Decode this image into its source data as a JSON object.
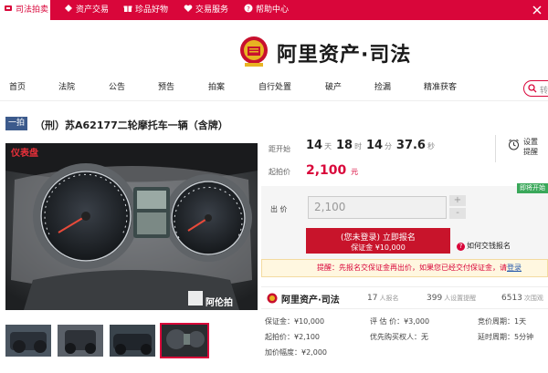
{
  "topbar": {
    "tabs": [
      {
        "label": "司法拍卖",
        "icon": "gavel-icon",
        "active": true
      },
      {
        "label": "资产交易",
        "icon": "diamond-icon",
        "active": false
      },
      {
        "label": "珍品好物",
        "icon": "gift-icon",
        "active": false
      },
      {
        "label": "交易服务",
        "icon": "heart-icon",
        "active": false
      },
      {
        "label": "帮助中心",
        "icon": "question-icon",
        "active": false
      }
    ],
    "close_icon": "close-icon",
    "bg_color": "#d9063a"
  },
  "header": {
    "logo_text": "阿里资产·司法"
  },
  "nav": {
    "items": [
      "首页",
      "法院",
      "公告",
      "预告",
      "拍案",
      "自行处置",
      "破产",
      "捡漏",
      "精准获客"
    ],
    "search_placeholder": "转"
  },
  "item": {
    "badge": "一拍",
    "title": "（刑）苏A62177二轮摩托车一辆（含牌）",
    "photo_tag": "仪表盘",
    "watermark": "阿伦拍"
  },
  "countdown": {
    "label": "距开始",
    "days": "14",
    "days_unit": "天",
    "hours": "18",
    "hours_unit": "时",
    "minutes": "14",
    "minutes_unit": "分",
    "seconds": "37.6",
    "seconds_unit": "秒"
  },
  "reminder": {
    "line1": "设置",
    "line2": "提醒"
  },
  "start_price": {
    "label": "起拍价",
    "value": "2,100",
    "unit": "元"
  },
  "bid": {
    "status_tag": "即将开始",
    "label": "出 价",
    "value": "2,100",
    "plus": "+",
    "minus": "-",
    "signup_line1": "(您未登录) 立即报名",
    "signup_line2": "保证金 ¥10,000",
    "howto": "如何交钱报名"
  },
  "tip": {
    "prefix": "提醒：先报名交保证金再出价，如果您已经交付保证金，请",
    "link": "登录"
  },
  "stats": {
    "logo": "阿里资产·司法",
    "signups": "17",
    "signups_unit": "人报名",
    "reminders": "399",
    "reminders_unit": "人设置提醒",
    "views": "6513",
    "views_unit": "次围观"
  },
  "details": {
    "deposit_label": "保证金：",
    "deposit": "¥10,000",
    "start_label": "起拍价：",
    "start": "¥2,100",
    "increment_label": "加价幅度：",
    "increment": "¥2,000",
    "appraisal_label": "评 估 价：",
    "appraisal": "¥3,000",
    "priority_label": "优先购买权人：",
    "priority": "无",
    "period_label": "竞价周期：",
    "period": "1天",
    "delay_label": "延时周期：",
    "delay": "5分钟"
  }
}
